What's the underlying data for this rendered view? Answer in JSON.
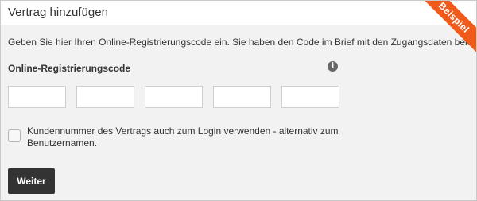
{
  "dialog": {
    "title": "Vertrag hinzufügen",
    "ribbon_label": "Beispiel",
    "intro_text": "Geben Sie hier Ihren Online-Registrierungscode ein. Sie haben den Code im Brief mit den Zugangsdaten bekommen.",
    "field_label": "Online-Registrierungscode",
    "info_icon": "info-icon",
    "code_inputs": [
      {
        "value": ""
      },
      {
        "value": ""
      },
      {
        "value": ""
      },
      {
        "value": ""
      },
      {
        "value": ""
      }
    ],
    "checkbox": {
      "checked": false,
      "label": "Kundennummer des Vertrags auch zum Login verwenden - alternativ zum Benutzernamen."
    },
    "submit_label": "Weiter"
  },
  "colors": {
    "ribbon": "#f05a1a",
    "button": "#333333",
    "background": "#f2f2f2"
  }
}
